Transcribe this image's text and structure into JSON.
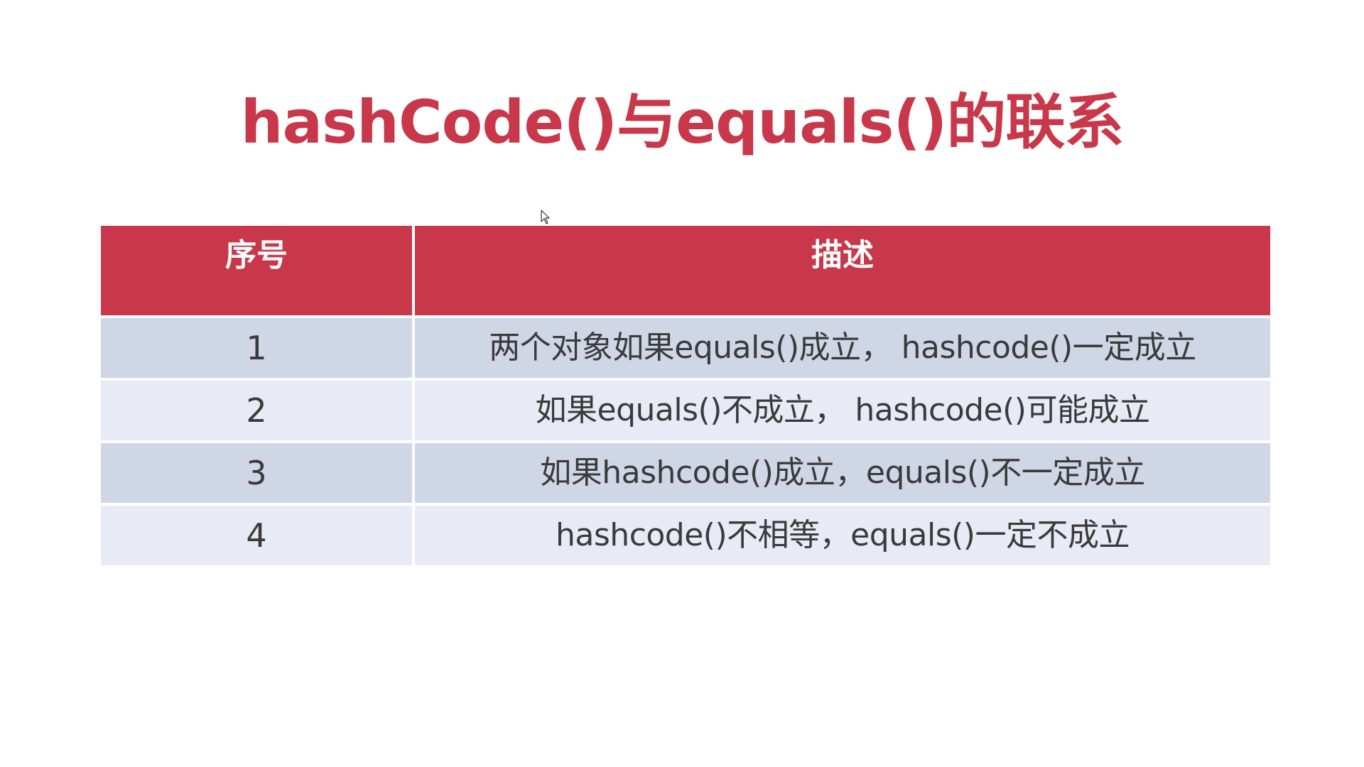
{
  "slide": {
    "title": "hashCode()与equals()的联系"
  },
  "table": {
    "headers": {
      "number": "序号",
      "description": "描述"
    },
    "rows": [
      {
        "number": "1",
        "description": "两个对象如果equals()成立， hashcode()一定成立"
      },
      {
        "number": "2",
        "description": "如果equals()不成立， hashcode()可能成立"
      },
      {
        "number": "3",
        "description": "如果hashcode()成立，equals()不一定成立"
      },
      {
        "number": "4",
        "description": "hashcode()不相等，equals()一定不成立"
      }
    ]
  },
  "colors": {
    "accent": "#c8384a",
    "row_odd": "#cfd6e6",
    "row_even": "#e8ebf5",
    "text": "#3a3a3a"
  }
}
